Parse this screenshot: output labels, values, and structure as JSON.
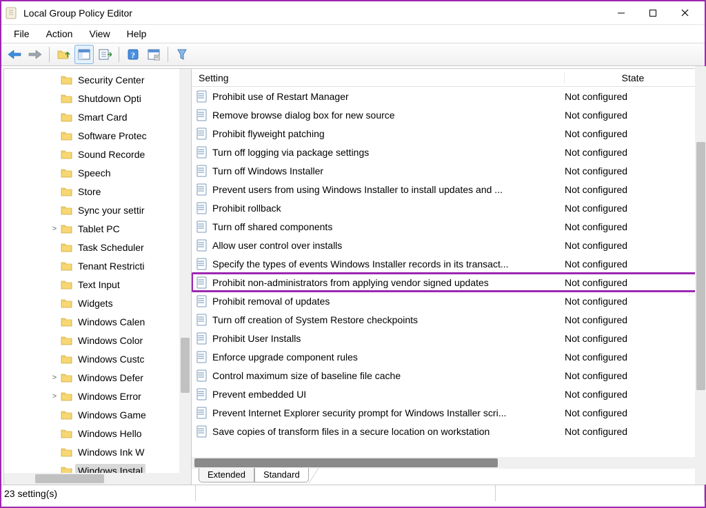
{
  "window": {
    "title": "Local Group Policy Editor"
  },
  "menu": {
    "file": "File",
    "action": "Action",
    "view": "View",
    "help": "Help"
  },
  "tree": {
    "items": [
      {
        "label": "Security Center",
        "expander": ""
      },
      {
        "label": "Shutdown Opti",
        "expander": ""
      },
      {
        "label": "Smart Card",
        "expander": ""
      },
      {
        "label": "Software Protec",
        "expander": ""
      },
      {
        "label": "Sound Recorde",
        "expander": ""
      },
      {
        "label": "Speech",
        "expander": ""
      },
      {
        "label": "Store",
        "expander": ""
      },
      {
        "label": "Sync your settir",
        "expander": ""
      },
      {
        "label": "Tablet PC",
        "expander": ">"
      },
      {
        "label": "Task Scheduler",
        "expander": ""
      },
      {
        "label": "Tenant Restricti",
        "expander": ""
      },
      {
        "label": "Text Input",
        "expander": ""
      },
      {
        "label": "Widgets",
        "expander": ""
      },
      {
        "label": "Windows Calen",
        "expander": ""
      },
      {
        "label": "Windows Color",
        "expander": ""
      },
      {
        "label": "Windows Custc",
        "expander": ""
      },
      {
        "label": "Windows Defer",
        "expander": ">"
      },
      {
        "label": "Windows Error",
        "expander": ">"
      },
      {
        "label": "Windows Game",
        "expander": ""
      },
      {
        "label": "Windows Hello",
        "expander": ""
      },
      {
        "label": "Windows Ink W",
        "expander": ""
      },
      {
        "label": "Windows Instal",
        "expander": "",
        "selected": true
      }
    ]
  },
  "columns": {
    "setting": "Setting",
    "state": "State"
  },
  "settings": [
    {
      "name": "Prohibit use of Restart Manager",
      "state": "Not configured"
    },
    {
      "name": "Remove browse dialog box for new source",
      "state": "Not configured"
    },
    {
      "name": "Prohibit flyweight patching",
      "state": "Not configured"
    },
    {
      "name": "Turn off logging via package settings",
      "state": "Not configured"
    },
    {
      "name": "Turn off Windows Installer",
      "state": "Not configured"
    },
    {
      "name": "Prevent users from using Windows Installer to install updates and ...",
      "state": "Not configured"
    },
    {
      "name": "Prohibit rollback",
      "state": "Not configured"
    },
    {
      "name": "Turn off shared components",
      "state": "Not configured"
    },
    {
      "name": "Allow user control over installs",
      "state": "Not configured"
    },
    {
      "name": "Specify the types of events Windows Installer records in its transact...",
      "state": "Not configured"
    },
    {
      "name": "Prohibit non-administrators from applying vendor signed updates",
      "state": "Not configured",
      "highlighted": true
    },
    {
      "name": "Prohibit removal of updates",
      "state": "Not configured"
    },
    {
      "name": "Turn off creation of System Restore checkpoints",
      "state": "Not configured"
    },
    {
      "name": "Prohibit User Installs",
      "state": "Not configured"
    },
    {
      "name": "Enforce upgrade component rules",
      "state": "Not configured"
    },
    {
      "name": "Control maximum size of baseline file cache",
      "state": "Not configured"
    },
    {
      "name": "Prevent embedded UI",
      "state": "Not configured"
    },
    {
      "name": "Prevent Internet Explorer security prompt for Windows Installer scri...",
      "state": "Not configured"
    },
    {
      "name": "Save copies of transform files in a secure location on workstation",
      "state": "Not configured"
    }
  ],
  "tabs": {
    "extended": "Extended",
    "standard": "Standard"
  },
  "status": {
    "count": "23 setting(s)"
  }
}
